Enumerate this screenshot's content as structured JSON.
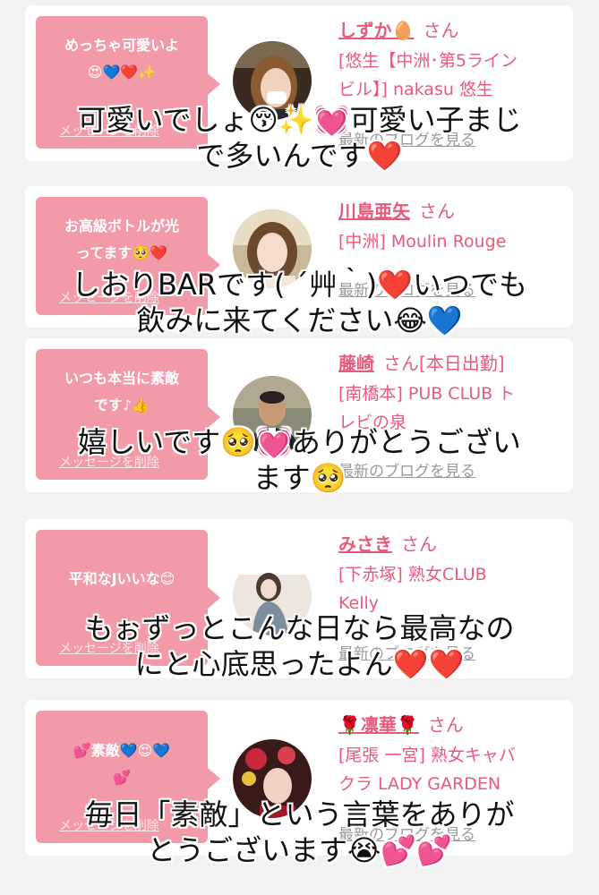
{
  "cards": [
    {
      "bubble_text_1": "めっちゃ可愛いよ",
      "bubble_text_2": "😍💙❤️✨",
      "delete_label": "メッセージを削除",
      "name": "しずか🥚",
      "san": "さん",
      "shop_1": "[悠生【中洲･第5ライン",
      "shop_2": "ビル】] nakasu 悠生",
      "blog_label": "最新のブログを見る",
      "overlay_1": "可愛いでしょ😚✨💓可愛い子まじ",
      "overlay_2": "で多いんです❤️"
    },
    {
      "bubble_text_1": "お高級ボトルが光",
      "bubble_text_2": "ってます🥺❤️",
      "delete_label": "メッセージを削除",
      "name": "川島亜矢",
      "san": "さん",
      "shop_1": "[中洲] Moulin Rouge",
      "shop_2": "",
      "blog_label": "最新のブログを見る",
      "overlay_1": "しおりBARです( ´艸｀)❤️いつでも",
      "overlay_2": "飲みに来てください😂💙"
    },
    {
      "bubble_text_1": "いつも本当に素敵",
      "bubble_text_2": "です♪👍",
      "delete_label": "メッセージを削除",
      "name": "藤崎",
      "san": "さん[本日出勤]",
      "shop_1": "[南橋本] PUB CLUB ト",
      "shop_2": "レビの泉",
      "blog_label": "最新のブログを見る",
      "overlay_1": "嬉しいです🥺💓ありがとうござい",
      "overlay_2": "ます🥺"
    },
    {
      "bubble_text_1": "平和なJいいな😊",
      "bubble_text_2": "",
      "delete_label": "メッセージを削除",
      "name": "みさき",
      "san": "さん",
      "shop_1": "[下赤塚] 熟女CLUB",
      "shop_2": "Kelly",
      "blog_label": "最新のブログを見る",
      "overlay_1": "もぉずっとこんな日なら最高なの",
      "overlay_2": "にと心底思ったよん❤️❤️"
    },
    {
      "bubble_text_1": "💕素敵💙😍💙",
      "bubble_text_2": "💕",
      "delete_label": "メッセージを削除",
      "name": "🌹凛華🌹",
      "san": "さん",
      "shop_1": "[尾張 一宮] 熟女キャバ",
      "shop_2": "クラ LADY GARDEN",
      "blog_label": "最新のブログを見る",
      "overlay_1": "毎日「素敵」という言葉をありが",
      "overlay_2": "とうございます😭💕💕"
    }
  ],
  "colors": {
    "bubble": "#f39aa9",
    "name": "#e85a7a",
    "page_bg": "#f2f2f2"
  }
}
